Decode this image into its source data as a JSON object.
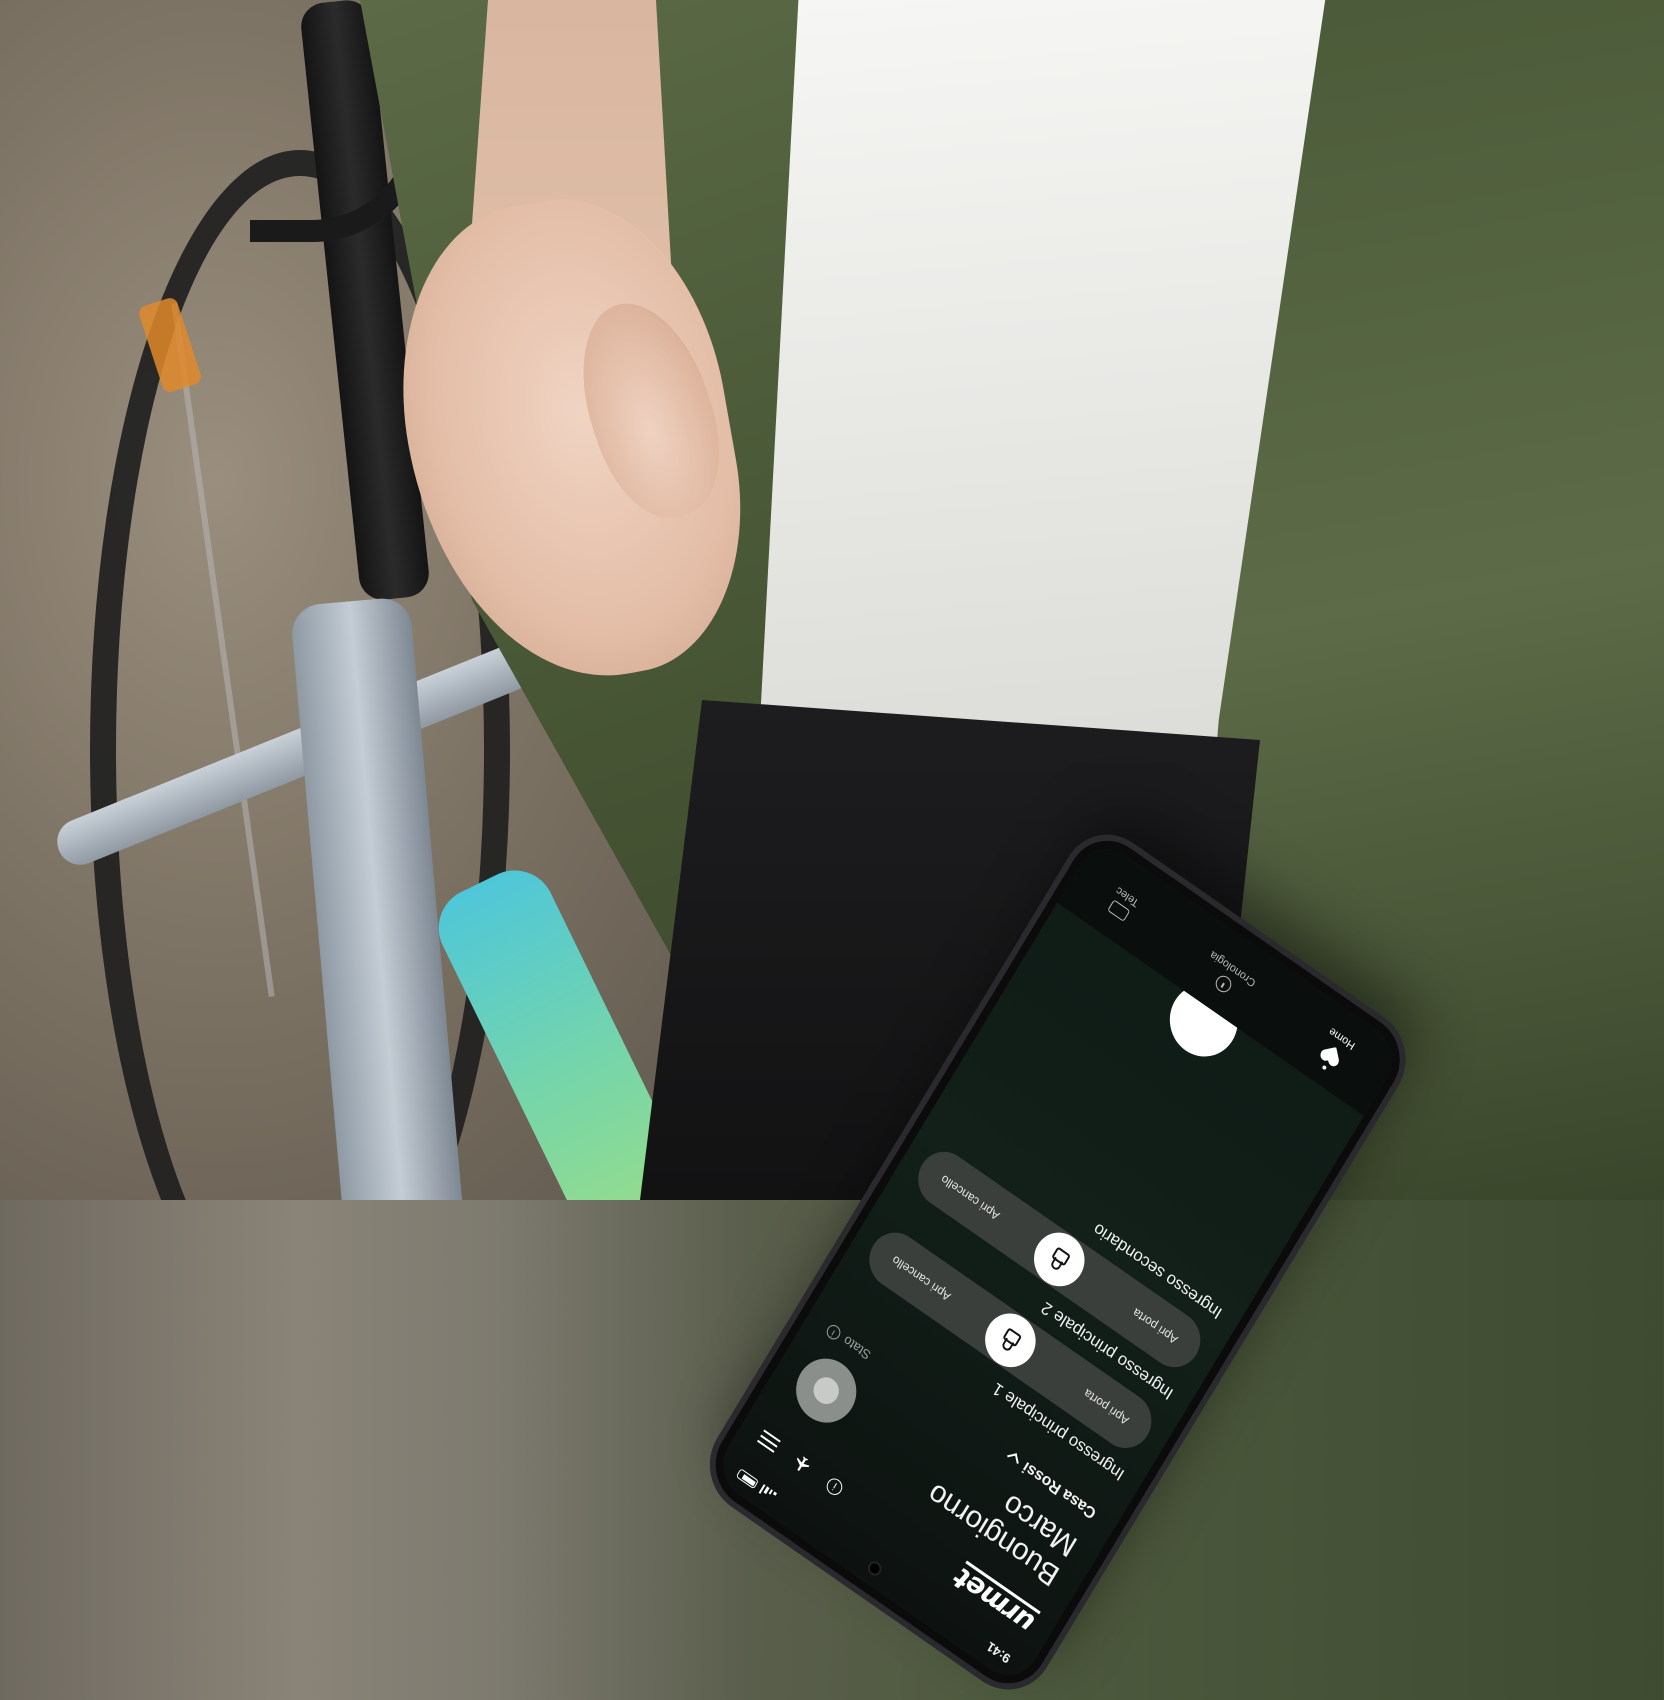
{
  "status": {
    "time": "9:41"
  },
  "brand": {
    "logo_text": "urmet"
  },
  "greeting": {
    "line1": "Buongiorno",
    "line2": "Marco"
  },
  "place": {
    "name": "Casa Rossi",
    "status_label": "Stato"
  },
  "entrances": [
    {
      "title": "Ingresso principale 1",
      "left_action": "Apri porta",
      "right_action": "Apri cancello"
    },
    {
      "title": "Ingresso principale 2",
      "left_action": "Apri porta",
      "right_action": "Apri cancello"
    },
    {
      "title": "Ingresso secondario",
      "left_action": "",
      "right_action": ""
    }
  ],
  "nav": {
    "home": "Home",
    "history": "Cronologia",
    "cameras": "Telec"
  },
  "icons": [
    "info-icon",
    "airplane-icon",
    "menu-icon",
    "chevron-down-icon",
    "lock-icon",
    "heart-icon",
    "clock-icon",
    "camera-icon"
  ],
  "colors": {
    "screen_bg": "#0f1a15",
    "pill_bg": "#3a3f3c",
    "accent": "#ffffff"
  }
}
